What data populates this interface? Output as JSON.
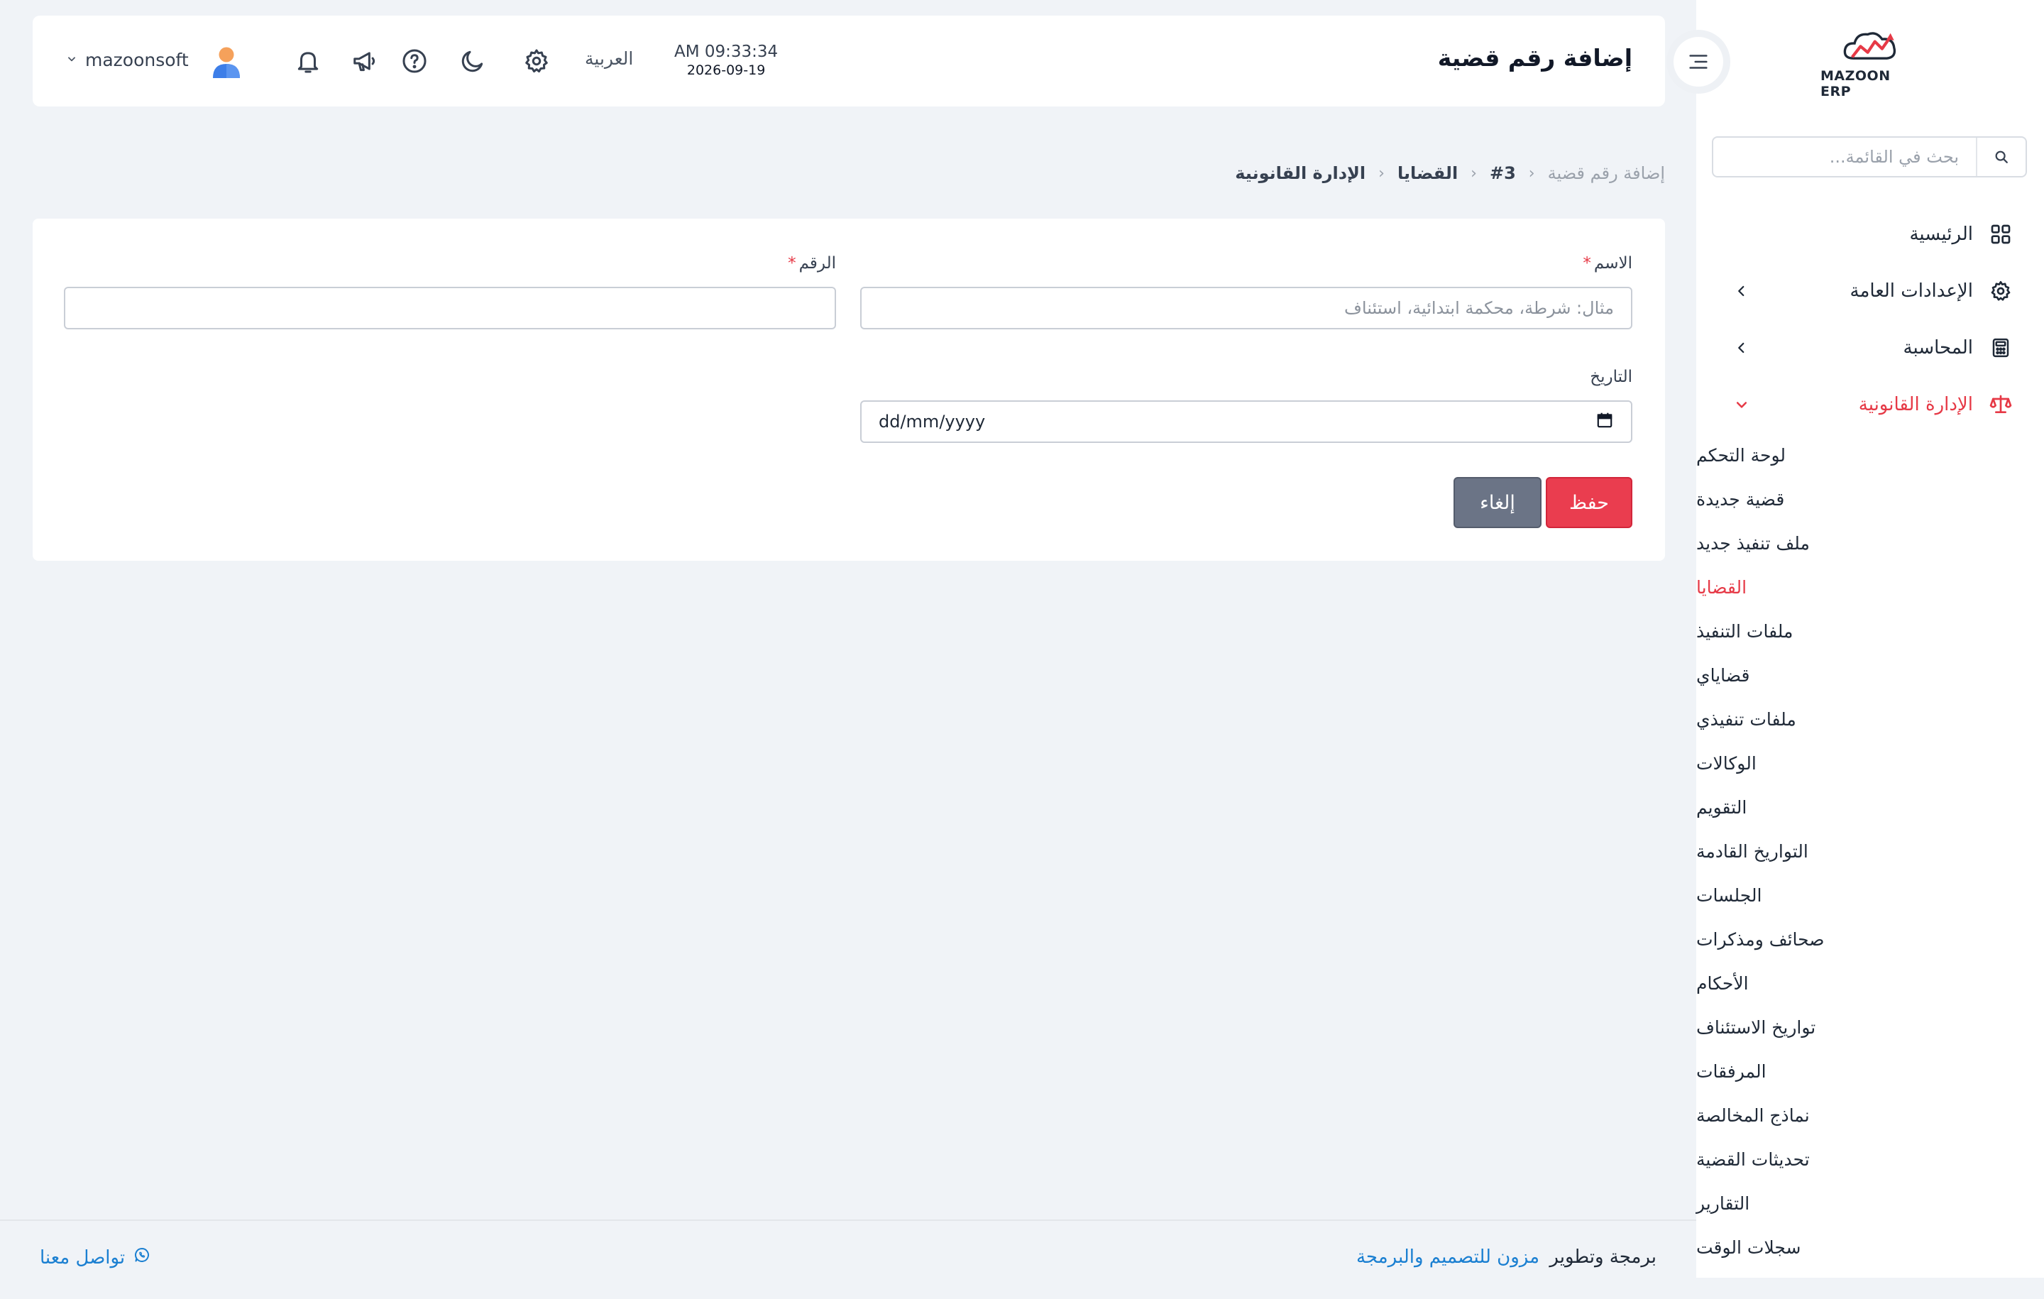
{
  "app": {
    "logo_text": "MAZOON ERP",
    "logo_subtext": "ERP"
  },
  "colors": {
    "accent": "#e63946",
    "save_button": "#ea3d4f",
    "cancel_button": "#6b7486",
    "link": "#1a7fd1",
    "background": "#f0f3f7"
  },
  "sidebar": {
    "search_placeholder": "بحث في القائمة...",
    "search_icon": "search-icon",
    "items": [
      {
        "label": "الرئيسية",
        "icon": "grid-icon"
      },
      {
        "label": "الإعدادات العامة",
        "icon": "gear-icon",
        "chevron": "chevron-left-icon"
      },
      {
        "label": "المحاسبة",
        "icon": "calculator-icon",
        "chevron": "chevron-left-icon"
      },
      {
        "label": "الإدارة القانونية",
        "icon": "scales-icon",
        "chevron": "chevron-down-icon",
        "active": true
      }
    ],
    "legal_submenu": [
      {
        "label": "لوحة التحكم"
      },
      {
        "label": "قضية جديدة"
      },
      {
        "label": "ملف تنفيذ جديد"
      },
      {
        "label": "القضايا",
        "active": true
      },
      {
        "label": "ملفات التنفيذ"
      },
      {
        "label": "قضاياي"
      },
      {
        "label": "ملفات تنفيذي"
      },
      {
        "label": "الوكالات"
      },
      {
        "label": "التقويم"
      },
      {
        "label": "التواريخ القادمة"
      },
      {
        "label": "الجلسات"
      },
      {
        "label": "صحائف ومذكرات"
      },
      {
        "label": "الأحكام"
      },
      {
        "label": "تواريخ الاستئناف"
      },
      {
        "label": "المرفقات"
      },
      {
        "label": "نماذج المخالصة"
      },
      {
        "label": "تحديثات القضية"
      },
      {
        "label": "التقارير"
      },
      {
        "label": "سجلات الوقت"
      }
    ]
  },
  "header": {
    "title": "إضافة رقم قضية",
    "time": "AM 09:33:34",
    "date": "2026-09-19",
    "language": "العربية",
    "username": "mazoonsoft",
    "icons": [
      "gear-icon",
      "moon-icon",
      "help-icon",
      "megaphone-icon",
      "bell-icon"
    ]
  },
  "breadcrumb": {
    "items": [
      "الإدارة القانونية",
      "القضايا",
      "#3"
    ],
    "current": "إضافة رقم قضية"
  },
  "form": {
    "name_label": "الاسم",
    "name_required": "*",
    "name_placeholder": "مثال: شرطة، محكمة ابتدائية، استئناف",
    "name_value": "",
    "number_label": "الرقم",
    "number_required": "*",
    "number_value": "",
    "date_label": "التاريخ",
    "date_placeholder": "dd/mm/yyyy",
    "save_label": "حفظ",
    "cancel_label": "إلغاء"
  },
  "footer": {
    "credit_prefix": "برمجة وتطوير",
    "credit_brand": "مزون للتصميم والبرمجة",
    "contact_label": "تواصل معنا"
  }
}
